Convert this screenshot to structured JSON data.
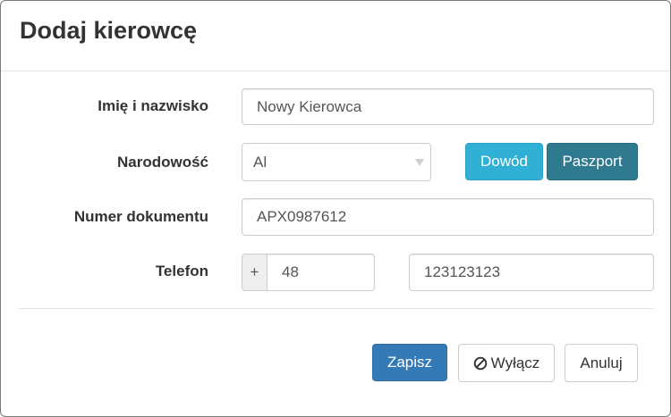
{
  "dialog": {
    "title": "Dodaj kierowcę"
  },
  "form": {
    "name": {
      "label": "Imię i nazwisko",
      "value": "Nowy Kierowca"
    },
    "nationality": {
      "label": "Narodowość",
      "selected": "Al"
    },
    "document_type": {
      "dowod_label": "Dowód",
      "paszport_label": "Paszport",
      "active": "Paszport"
    },
    "document_number": {
      "label": "Numer dokumentu",
      "value": "APX0987612"
    },
    "phone": {
      "label": "Telefon",
      "prefix_symbol": "+",
      "country_code": "48",
      "number": "123123123"
    }
  },
  "footer": {
    "save_label": "Zapisz",
    "disable_label": "Wyłącz",
    "cancel_label": "Anuluj"
  },
  "icons": {
    "disable": "ban-icon",
    "select_caret": "caret-down-icon"
  },
  "colors": {
    "primary": "#337ab7",
    "info": "#31b0d5",
    "active_toggle": "#2f7a8e"
  }
}
